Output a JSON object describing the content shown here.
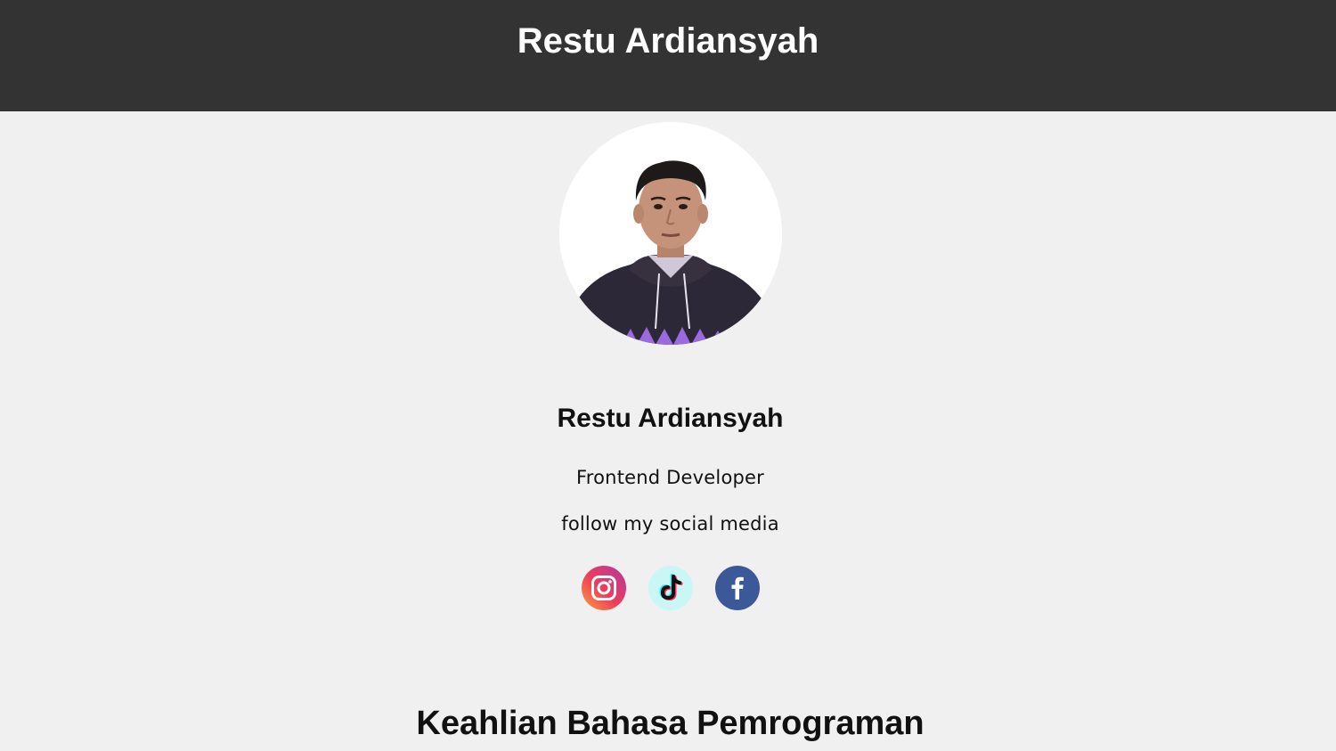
{
  "header": {
    "title": "Restu Ardiansyah"
  },
  "profile": {
    "name": "Restu Ardiansyah",
    "role": "Frontend Developer",
    "follow_text": "follow my social media"
  },
  "socials": [
    {
      "name": "instagram",
      "icon": "instagram-icon"
    },
    {
      "name": "tiktok",
      "icon": "tiktok-icon"
    },
    {
      "name": "facebook",
      "icon": "facebook-icon"
    }
  ],
  "sections": {
    "skills_title": "Keahlian Bahasa Pemrograman"
  },
  "colors": {
    "header_bg": "#333333",
    "page_bg": "#f0f0f0",
    "facebook": "#3b5998"
  }
}
